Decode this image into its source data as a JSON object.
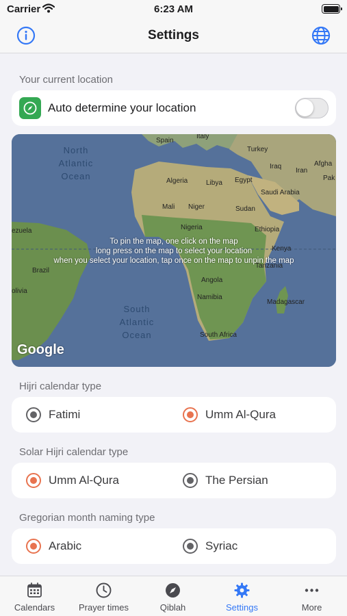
{
  "status_bar": {
    "carrier": "Carrier",
    "time": "6:23 AM"
  },
  "nav": {
    "title": "Settings",
    "left_icon": "info-icon",
    "right_icon": "globe-icon"
  },
  "location": {
    "section_label": "Your current location",
    "auto_label": "Auto determine your location",
    "auto_enabled": false
  },
  "map": {
    "hint_lines": [
      "To pin the map, one click on the map",
      "long press on the map to select your location",
      "when you select your location, tap once on the map to unpin the map"
    ],
    "labels": {
      "spain": "Spain",
      "italy": "Italy",
      "turkey": "Turkey",
      "iraq": "Iraq",
      "afghanistan": "Afgha",
      "iran": "Iran",
      "pakistan": "Pak",
      "algeria": "Algeria",
      "libya": "Libya",
      "egypt": "Egypt",
      "saudi": "Saudi Arabia",
      "mali": "Mali",
      "niger": "Niger",
      "sudan": "Sudan",
      "nigeria": "Nigeria",
      "ethiopia": "Ethiopia",
      "venezuela": "ezuela",
      "kenya": "Kenya",
      "tanzania": "Tanzania",
      "brazil": "Brazil",
      "bolivia": "olivia",
      "angola": "Angola",
      "namibia": "Namibia",
      "madagascar": "Madagascar",
      "south_africa": "South Africa",
      "north_atlantic": [
        "North",
        "Atlantic",
        "Ocean"
      ],
      "south_atlantic": [
        "South",
        "Atlantic",
        "Ocean"
      ],
      "google": "Google"
    }
  },
  "hijri": {
    "section_label": "Hijri calendar type",
    "options": [
      "Fatimi",
      "Umm Al-Qura"
    ],
    "selected": "Umm Al-Qura"
  },
  "solar_hijri": {
    "section_label": "Solar Hijri calendar type",
    "options": [
      "Umm Al-Qura",
      "The Persian"
    ],
    "selected": "Umm Al-Qura"
  },
  "gregorian": {
    "section_label": "Gregorian month naming type",
    "options": [
      "Arabic",
      "Syriac"
    ],
    "selected": "Arabic"
  },
  "tabs": [
    {
      "label": "Calendars",
      "icon": "calendar-icon"
    },
    {
      "label": "Prayer times",
      "icon": "clock-icon"
    },
    {
      "label": "Qiblah",
      "icon": "compass-icon"
    },
    {
      "label": "Settings",
      "icon": "gear-icon",
      "active": true
    },
    {
      "label": "More",
      "icon": "more-icon"
    }
  ],
  "colors": {
    "accent": "#e8734f",
    "tab_active": "#3478f6",
    "location_icon_bg": "#34a853"
  }
}
